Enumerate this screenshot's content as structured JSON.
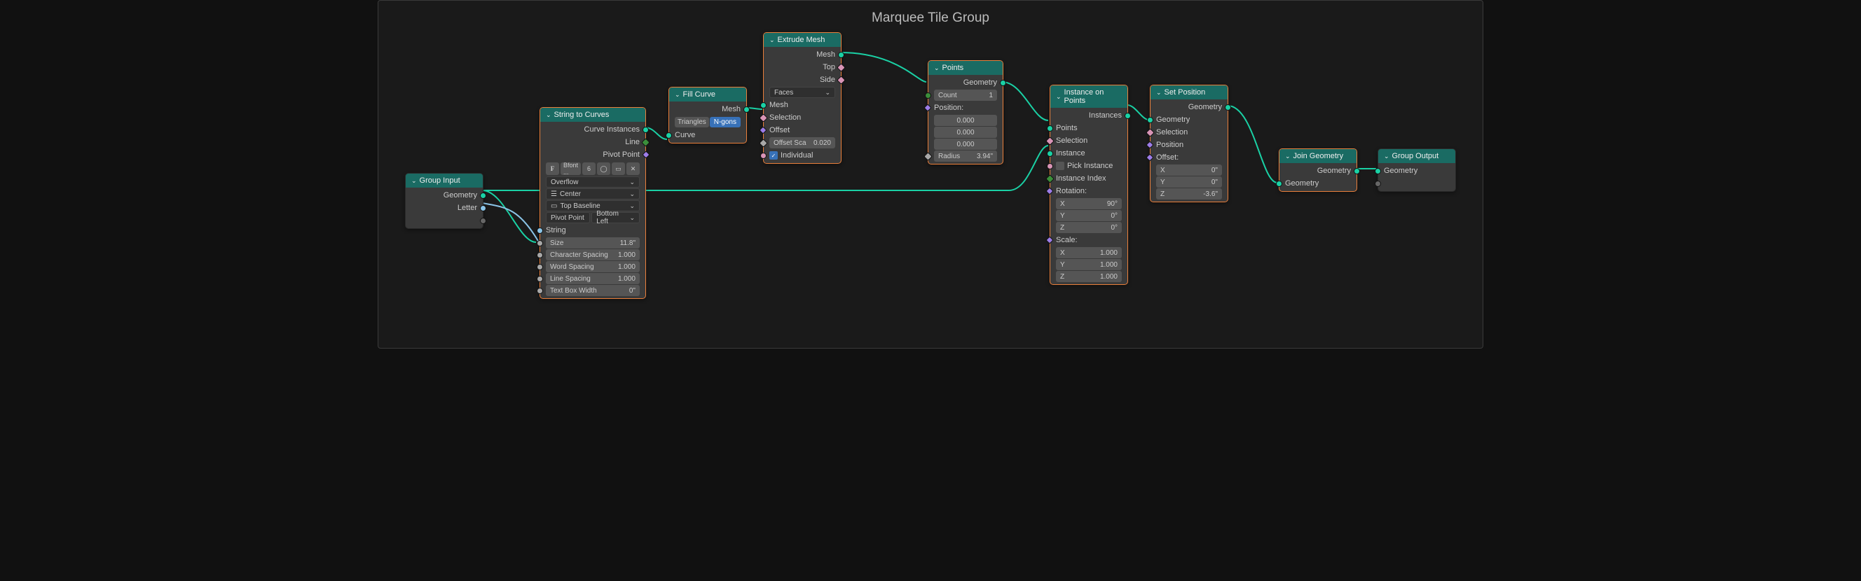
{
  "title": "Marquee Tile Group",
  "groupInput": {
    "header": "Group Input",
    "geometry": "Geometry",
    "letter": "Letter"
  },
  "stc": {
    "header": "String to Curves",
    "ci": "Curve Instances",
    "line": "Line",
    "pp": "Pivot Point",
    "font": "Bfont ...",
    "fontNum": "6",
    "overflow": "Overflow",
    "align": "Center",
    "baseline": "Top Baseline",
    "ppLabel": "Pivot Point",
    "ppVal": "Bottom Left",
    "string": "String",
    "size": "Size",
    "sizeV": "11.8\"",
    "cs": "Character Spacing",
    "csV": "1.000",
    "ws": "Word Spacing",
    "wsV": "1.000",
    "ls": "Line Spacing",
    "lsV": "1.000",
    "tbw": "Text Box Width",
    "tbwV": "0\""
  },
  "fc": {
    "header": "Fill Curve",
    "mesh": "Mesh",
    "tri": "Triangles",
    "ngon": "N-gons",
    "curve": "Curve"
  },
  "em": {
    "header": "Extrude Mesh",
    "mesh": "Mesh",
    "top": "Top",
    "side": "Side",
    "mode": "Faces",
    "meshIn": "Mesh",
    "sel": "Selection",
    "off": "Offset",
    "osc": "Offset Sca",
    "oscV": "0.020",
    "ind": "Individual"
  },
  "pts": {
    "header": "Points",
    "geo": "Geometry",
    "count": "Count",
    "countV": "1",
    "pos": "Position:",
    "v0": "0.000",
    "rad": "Radius",
    "radV": "3.94\""
  },
  "iop": {
    "header": "Instance on Points",
    "inst": "Instances",
    "points": "Points",
    "sel": "Selection",
    "instance": "Instance",
    "pick": "Pick Instance",
    "ii": "Instance Index",
    "rot": "Rotation:",
    "x": "X",
    "y": "Y",
    "z": "Z",
    "rxV": "90°",
    "ryV": "0°",
    "rzV": "0°",
    "scale": "Scale:",
    "sxV": "1.000",
    "syV": "1.000",
    "szV": "1.000"
  },
  "sp": {
    "header": "Set Position",
    "geo": "Geometry",
    "geoIn": "Geometry",
    "sel": "Selection",
    "pos": "Position",
    "off": "Offset:",
    "x": "X",
    "y": "Y",
    "z": "Z",
    "xV": "0\"",
    "yV": "0\"",
    "zV": "-3.6\""
  },
  "jg": {
    "header": "Join Geometry",
    "geo": "Geometry",
    "geoIn": "Geometry"
  },
  "go": {
    "header": "Group Output",
    "geo": "Geometry"
  }
}
